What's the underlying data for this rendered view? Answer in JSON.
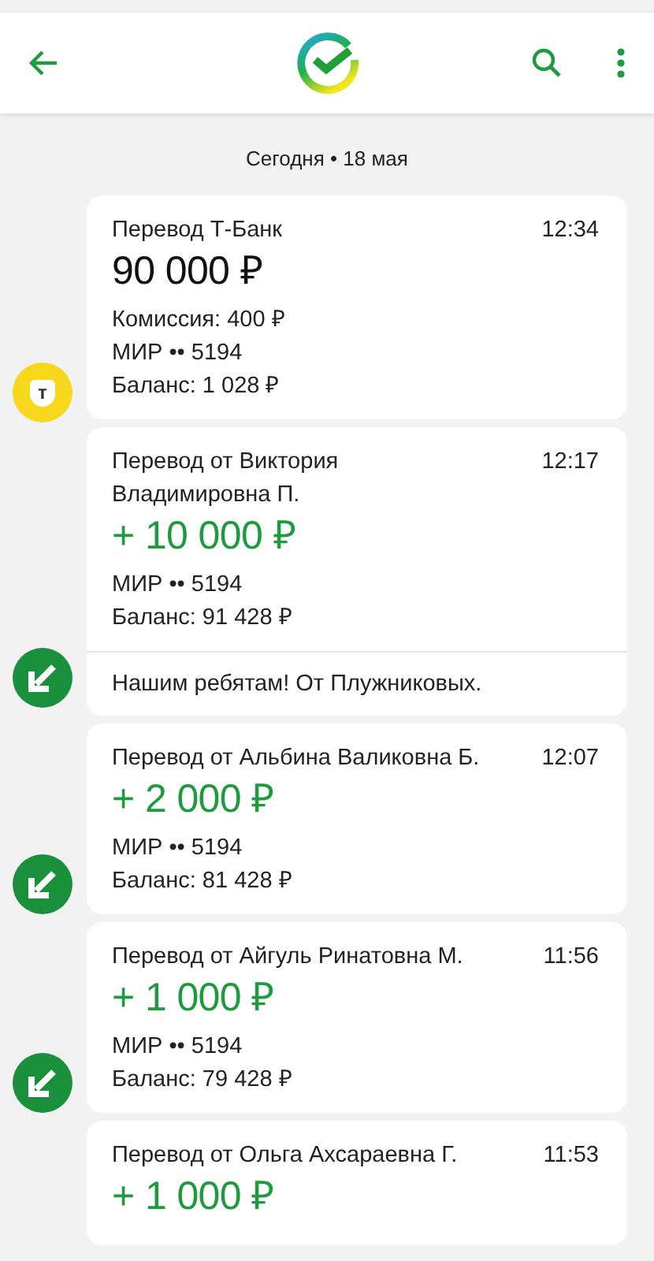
{
  "date_header": "Сегодня • 18 мая",
  "transactions": [
    {
      "kind": "outgoing",
      "badge": {
        "kind": "bank",
        "letter": "т"
      },
      "title": "Перевод Т-Банк",
      "time": "12:34",
      "amount": "90 000 ₽",
      "details": [
        "Комиссия: 400 ₽",
        "МИР •• 5194",
        "Баланс: 1 028 ₽"
      ]
    },
    {
      "kind": "incoming",
      "badge": {
        "kind": "arrow"
      },
      "title": "Перевод от Виктория Владимировна П.",
      "time": "12:17",
      "amount": "+ 10 000 ₽",
      "details": [
        "МИР •• 5194",
        "Баланс: 91 428 ₽"
      ],
      "comment": "Нашим ребятам! От Плужниковых."
    },
    {
      "kind": "incoming",
      "badge": {
        "kind": "arrow"
      },
      "title": "Перевод от Альбина Валиковна Б.",
      "time": "12:07",
      "amount": "+ 2 000 ₽",
      "details": [
        "МИР •• 5194",
        "Баланс: 81 428 ₽"
      ]
    },
    {
      "kind": "incoming",
      "badge": {
        "kind": "arrow"
      },
      "title": "Перевод от Айгуль Ринатовна М.",
      "time": "11:56",
      "amount": "+ 1 000 ₽",
      "details": [
        "МИР •• 5194",
        "Баланс: 79 428 ₽"
      ]
    },
    {
      "kind": "incoming",
      "title": "Перевод от Ольга Ахсараевна Г.",
      "time": "11:53",
      "amount": "+ 1 000 ₽"
    }
  ]
}
